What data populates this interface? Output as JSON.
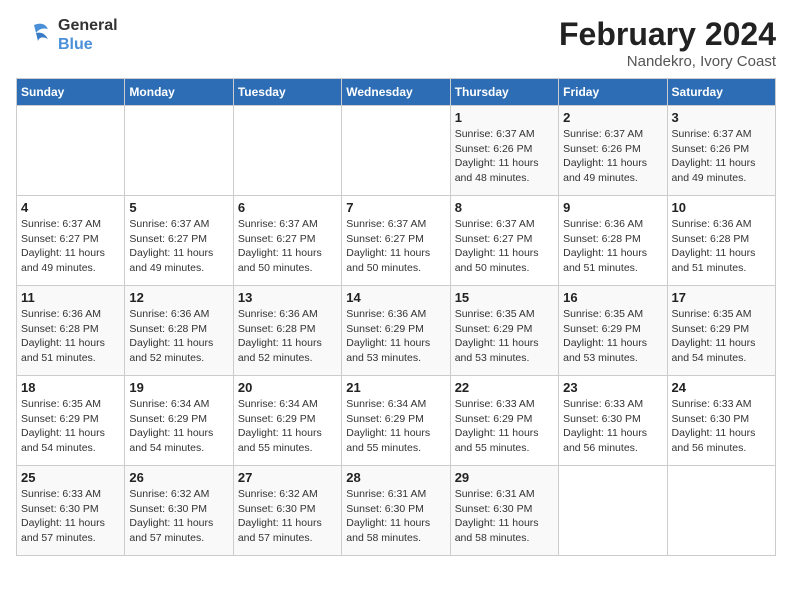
{
  "logo": {
    "line1": "General",
    "line2": "Blue"
  },
  "title": "February 2024",
  "subtitle": "Nandekro, Ivory Coast",
  "days_of_week": [
    "Sunday",
    "Monday",
    "Tuesday",
    "Wednesday",
    "Thursday",
    "Friday",
    "Saturday"
  ],
  "weeks": [
    [
      {
        "day": "",
        "info": ""
      },
      {
        "day": "",
        "info": ""
      },
      {
        "day": "",
        "info": ""
      },
      {
        "day": "",
        "info": ""
      },
      {
        "day": "1",
        "info": "Sunrise: 6:37 AM\nSunset: 6:26 PM\nDaylight: 11 hours\nand 48 minutes."
      },
      {
        "day": "2",
        "info": "Sunrise: 6:37 AM\nSunset: 6:26 PM\nDaylight: 11 hours\nand 49 minutes."
      },
      {
        "day": "3",
        "info": "Sunrise: 6:37 AM\nSunset: 6:26 PM\nDaylight: 11 hours\nand 49 minutes."
      }
    ],
    [
      {
        "day": "4",
        "info": "Sunrise: 6:37 AM\nSunset: 6:27 PM\nDaylight: 11 hours\nand 49 minutes."
      },
      {
        "day": "5",
        "info": "Sunrise: 6:37 AM\nSunset: 6:27 PM\nDaylight: 11 hours\nand 49 minutes."
      },
      {
        "day": "6",
        "info": "Sunrise: 6:37 AM\nSunset: 6:27 PM\nDaylight: 11 hours\nand 50 minutes."
      },
      {
        "day": "7",
        "info": "Sunrise: 6:37 AM\nSunset: 6:27 PM\nDaylight: 11 hours\nand 50 minutes."
      },
      {
        "day": "8",
        "info": "Sunrise: 6:37 AM\nSunset: 6:27 PM\nDaylight: 11 hours\nand 50 minutes."
      },
      {
        "day": "9",
        "info": "Sunrise: 6:36 AM\nSunset: 6:28 PM\nDaylight: 11 hours\nand 51 minutes."
      },
      {
        "day": "10",
        "info": "Sunrise: 6:36 AM\nSunset: 6:28 PM\nDaylight: 11 hours\nand 51 minutes."
      }
    ],
    [
      {
        "day": "11",
        "info": "Sunrise: 6:36 AM\nSunset: 6:28 PM\nDaylight: 11 hours\nand 51 minutes."
      },
      {
        "day": "12",
        "info": "Sunrise: 6:36 AM\nSunset: 6:28 PM\nDaylight: 11 hours\nand 52 minutes."
      },
      {
        "day": "13",
        "info": "Sunrise: 6:36 AM\nSunset: 6:28 PM\nDaylight: 11 hours\nand 52 minutes."
      },
      {
        "day": "14",
        "info": "Sunrise: 6:36 AM\nSunset: 6:29 PM\nDaylight: 11 hours\nand 53 minutes."
      },
      {
        "day": "15",
        "info": "Sunrise: 6:35 AM\nSunset: 6:29 PM\nDaylight: 11 hours\nand 53 minutes."
      },
      {
        "day": "16",
        "info": "Sunrise: 6:35 AM\nSunset: 6:29 PM\nDaylight: 11 hours\nand 53 minutes."
      },
      {
        "day": "17",
        "info": "Sunrise: 6:35 AM\nSunset: 6:29 PM\nDaylight: 11 hours\nand 54 minutes."
      }
    ],
    [
      {
        "day": "18",
        "info": "Sunrise: 6:35 AM\nSunset: 6:29 PM\nDaylight: 11 hours\nand 54 minutes."
      },
      {
        "day": "19",
        "info": "Sunrise: 6:34 AM\nSunset: 6:29 PM\nDaylight: 11 hours\nand 54 minutes."
      },
      {
        "day": "20",
        "info": "Sunrise: 6:34 AM\nSunset: 6:29 PM\nDaylight: 11 hours\nand 55 minutes."
      },
      {
        "day": "21",
        "info": "Sunrise: 6:34 AM\nSunset: 6:29 PM\nDaylight: 11 hours\nand 55 minutes."
      },
      {
        "day": "22",
        "info": "Sunrise: 6:33 AM\nSunset: 6:29 PM\nDaylight: 11 hours\nand 55 minutes."
      },
      {
        "day": "23",
        "info": "Sunrise: 6:33 AM\nSunset: 6:30 PM\nDaylight: 11 hours\nand 56 minutes."
      },
      {
        "day": "24",
        "info": "Sunrise: 6:33 AM\nSunset: 6:30 PM\nDaylight: 11 hours\nand 56 minutes."
      }
    ],
    [
      {
        "day": "25",
        "info": "Sunrise: 6:33 AM\nSunset: 6:30 PM\nDaylight: 11 hours\nand 57 minutes."
      },
      {
        "day": "26",
        "info": "Sunrise: 6:32 AM\nSunset: 6:30 PM\nDaylight: 11 hours\nand 57 minutes."
      },
      {
        "day": "27",
        "info": "Sunrise: 6:32 AM\nSunset: 6:30 PM\nDaylight: 11 hours\nand 57 minutes."
      },
      {
        "day": "28",
        "info": "Sunrise: 6:31 AM\nSunset: 6:30 PM\nDaylight: 11 hours\nand 58 minutes."
      },
      {
        "day": "29",
        "info": "Sunrise: 6:31 AM\nSunset: 6:30 PM\nDaylight: 11 hours\nand 58 minutes."
      },
      {
        "day": "",
        "info": ""
      },
      {
        "day": "",
        "info": ""
      }
    ]
  ]
}
